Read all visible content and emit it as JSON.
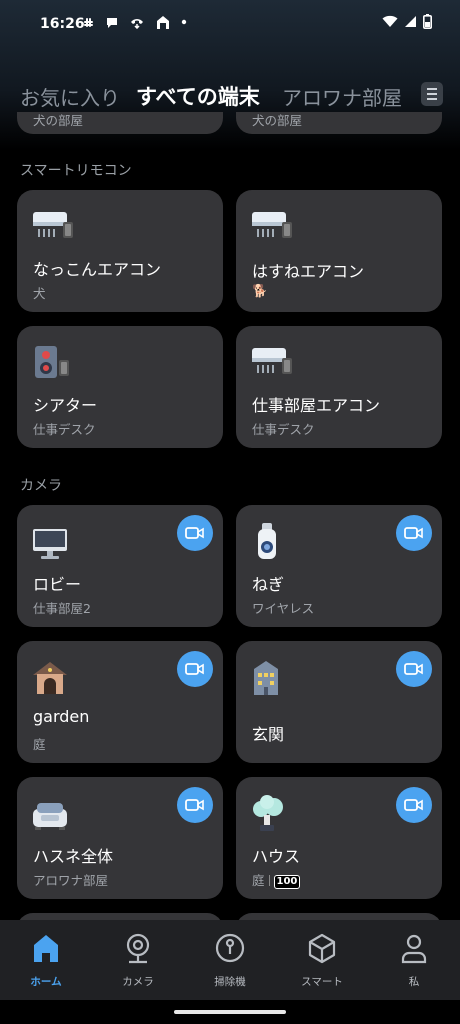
{
  "status_bar": {
    "time": "16:26",
    "notification_icons": [
      "slack-icon",
      "chat-bubble-icon",
      "call-icon",
      "home-app-icon",
      "dot-icon"
    ],
    "system_icons": [
      "wifi-icon",
      "signal-icon",
      "battery-icon"
    ]
  },
  "tabs": {
    "items": [
      {
        "label": "お気に入り",
        "active": false
      },
      {
        "label": "すべての端末",
        "active": true
      },
      {
        "label": "アロワナ部屋",
        "active": false
      }
    ],
    "menu_icon": "hamburger-icon"
  },
  "top_partial": {
    "left_sub": "犬の部屋",
    "right_sub": "犬の部屋"
  },
  "sections": {
    "remote": "スマートリモコン",
    "camera": "カメラ"
  },
  "remote_devices": [
    {
      "name": "なっこんエアコン",
      "sub": "犬",
      "icon": "air-conditioner-icon"
    },
    {
      "name": "はすねエアコン",
      "sub": "🐕",
      "icon": "air-conditioner-icon"
    },
    {
      "name": "シアター",
      "sub": "仕事デスク",
      "icon": "speaker-icon"
    },
    {
      "name": "仕事部屋エアコン",
      "sub": "仕事デスク",
      "icon": "air-conditioner-icon"
    }
  ],
  "camera_devices": [
    {
      "name": "ロビー",
      "sub": "仕事部屋2",
      "icon": "monitor-icon"
    },
    {
      "name": "ねぎ",
      "sub": "ワイヤレス",
      "icon": "bullet-camera-icon"
    },
    {
      "name": "garden",
      "sub": "庭",
      "icon": "doghouse-icon"
    },
    {
      "name": "玄関",
      "sub": "",
      "icon": "building-icon"
    },
    {
      "name": "ハスネ全体",
      "sub": "アロワナ部屋",
      "icon": "robot-vacuum-icon"
    },
    {
      "name": "ハウス",
      "sub": "庭",
      "badge": "100",
      "icon": "tree-icon"
    }
  ],
  "bottom_nav": [
    {
      "label": "ホーム",
      "icon": "home-icon",
      "active": true
    },
    {
      "label": "カメラ",
      "icon": "camera-icon",
      "active": false
    },
    {
      "label": "掃除機",
      "icon": "vacuum-icon",
      "active": false
    },
    {
      "label": "スマート",
      "icon": "cube-icon",
      "active": false
    },
    {
      "label": "私",
      "icon": "person-icon",
      "active": false
    }
  ],
  "colors": {
    "accent": "#4ba3f0",
    "card": "#353538",
    "nav_bg": "#202124"
  }
}
